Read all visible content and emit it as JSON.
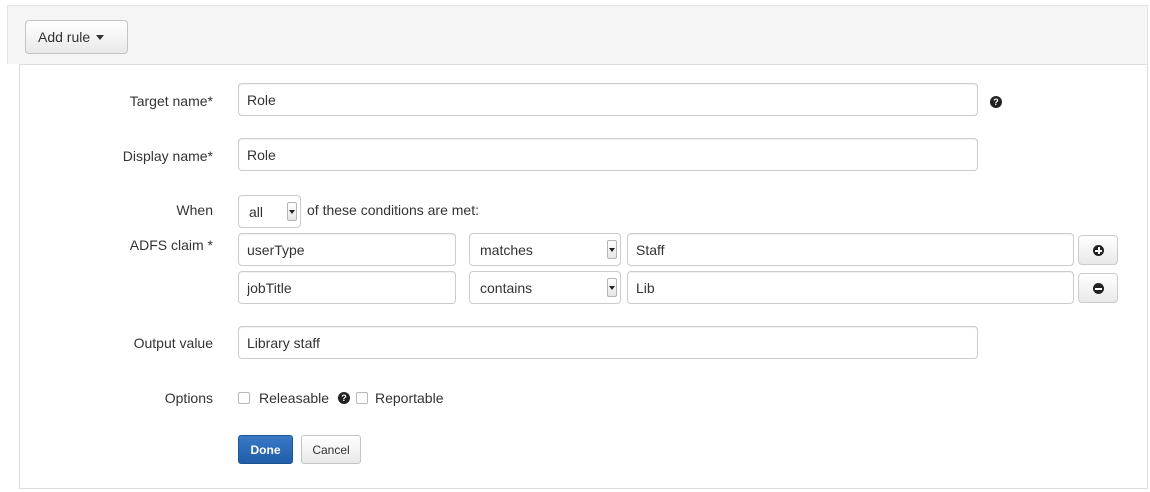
{
  "toolbar": {
    "add_rule_label": "Add rule"
  },
  "form": {
    "target_name": {
      "label": "Target name*",
      "value": "Role"
    },
    "display_name": {
      "label": "Display name*",
      "value": "Role"
    },
    "when": {
      "label": "When",
      "selected": "all",
      "suffix": "of these conditions are met:"
    },
    "adfs_claim": {
      "label": "ADFS claim *",
      "conditions": [
        {
          "claim": "userType",
          "operator": "matches",
          "value": "Staff",
          "action": "add"
        },
        {
          "claim": "jobTitle",
          "operator": "contains",
          "value": "Lib",
          "action": "remove"
        }
      ]
    },
    "output_value": {
      "label": "Output value",
      "value": "Library staff"
    },
    "options": {
      "label": "Options",
      "releasable": "Releasable",
      "reportable": "Reportable"
    },
    "buttons": {
      "done": "Done",
      "cancel": "Cancel"
    }
  },
  "icons": {
    "help": "question-circle-icon",
    "add": "plus-circle-icon",
    "remove": "minus-circle-icon"
  },
  "colors": {
    "primary": "#286bb8",
    "panel_border": "#dddddd",
    "toolbar_bg": "#f5f5f5"
  }
}
